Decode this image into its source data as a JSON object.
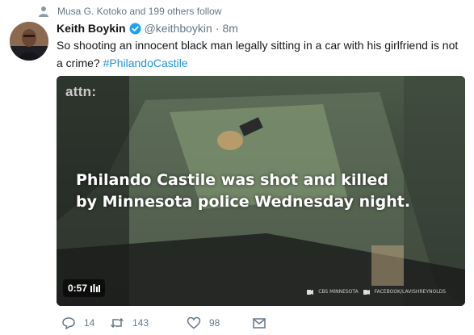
{
  "context": {
    "text": "Musa G. Kotoko and 199 others follow",
    "icon": "person-icon"
  },
  "tweet": {
    "author_name": "Keith Boykin",
    "handle": "@keithboykin",
    "separator": "·",
    "time": "8m",
    "text_before": "So shooting an innocent black man legally sitting in a car with his girlfriend is not a crime? ",
    "hashtag": "#PhilandoCastile"
  },
  "media": {
    "watermark": "attn:",
    "caption_line1": "Philando Castile was shot and killed",
    "caption_line2": "by Minnesota police Wednesday night.",
    "duration": "0:57",
    "credit1": "CBS MINNESOTA",
    "credit2": "FACEBOOK/LAVISHREYNOLDS"
  },
  "actions": {
    "reply_count": "14",
    "retweet_count": "143",
    "like_count": "98"
  },
  "colors": {
    "link": "#1b95e0",
    "verified": "#1da1f2",
    "muted": "#657786"
  }
}
